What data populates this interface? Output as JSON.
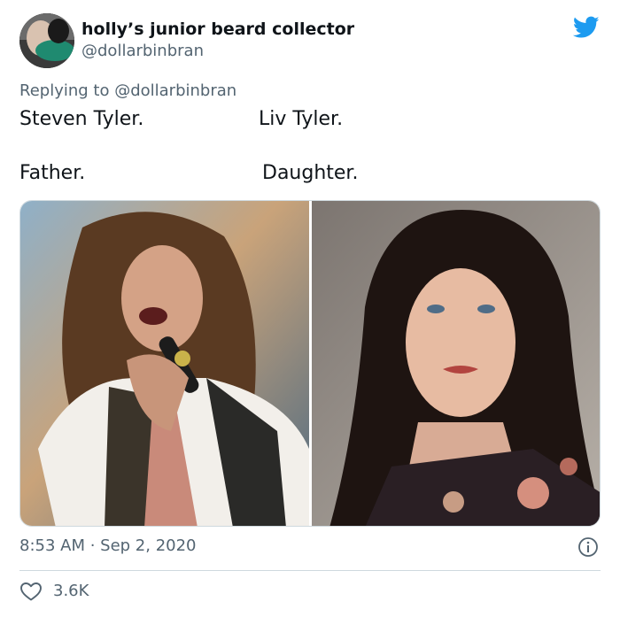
{
  "author": {
    "display_name": "holly’s junior beard collector",
    "handle": "@dollarbinbran"
  },
  "reply": {
    "prefix": "Replying to ",
    "mention": "@dollarbinbran"
  },
  "text": {
    "line1_left": "Steven Tyler.",
    "line1_right": "Liv Tyler.",
    "line2_left": "Father.",
    "line2_right": "Daughter."
  },
  "media": {
    "left_photo": "singer-performing-photo",
    "right_photo": "portrait-photo"
  },
  "meta": {
    "timestamp": "8:53 AM · Sep 2, 2020"
  },
  "actions": {
    "like_count": "3.6K"
  },
  "colors": {
    "brand": "#1d9bf0",
    "text": "#0f1419",
    "secondary": "#536471",
    "border": "#cfd9de"
  },
  "icons": {
    "brand": "twitter-bird-icon",
    "info": "info-icon",
    "like": "heart-icon"
  }
}
